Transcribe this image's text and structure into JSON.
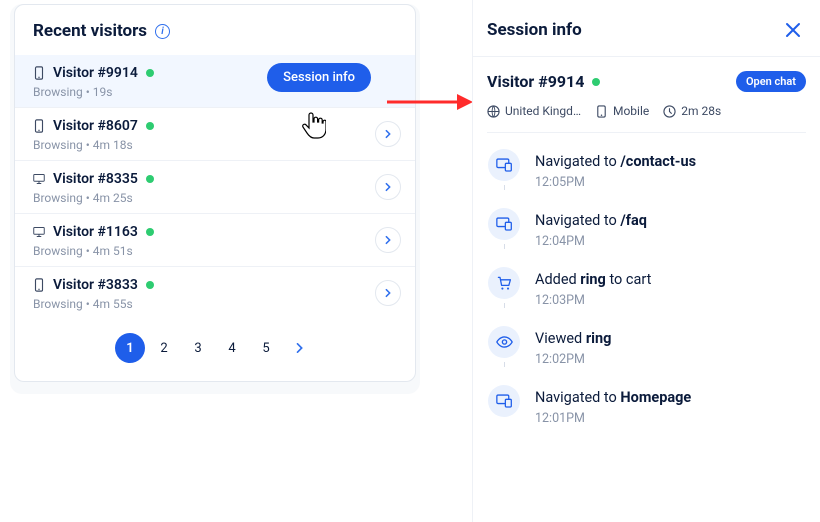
{
  "left": {
    "title": "Recent visitors",
    "visitors": [
      {
        "id": "Visitor #9914",
        "device": "mobile",
        "status": "Browsing",
        "duration": "19s",
        "highlighted": true,
        "pill": "Session info"
      },
      {
        "id": "Visitor #8607",
        "device": "mobile",
        "status": "Browsing",
        "duration": "4m 18s"
      },
      {
        "id": "Visitor #8335",
        "device": "desktop",
        "status": "Browsing",
        "duration": "4m 25s"
      },
      {
        "id": "Visitor #1163",
        "device": "desktop",
        "status": "Browsing",
        "duration": "4m 51s"
      },
      {
        "id": "Visitor #3833",
        "device": "mobile",
        "status": "Browsing",
        "duration": "4m 55s"
      }
    ],
    "pages": [
      "1",
      "2",
      "3",
      "4",
      "5"
    ],
    "active_page": "1"
  },
  "right": {
    "header": "Session info",
    "visitor": "Visitor #9914",
    "open_chat": "Open chat",
    "meta": {
      "country": "United Kingd…",
      "device": "Mobile",
      "duration": "2m 28s"
    },
    "timeline": [
      {
        "icon": "nav",
        "prefix": "Navigated to ",
        "bold": "/contact-us",
        "suffix": "",
        "time": "12:05PM"
      },
      {
        "icon": "nav",
        "prefix": "Navigated to ",
        "bold": "/faq",
        "suffix": "",
        "time": "12:04PM"
      },
      {
        "icon": "cart",
        "prefix": "Added ",
        "bold": "ring",
        "suffix": " to cart",
        "time": "12:03PM"
      },
      {
        "icon": "eye",
        "prefix": "Viewed ",
        "bold": "ring",
        "suffix": "",
        "time": "12:02PM"
      },
      {
        "icon": "nav",
        "prefix": "Navigated to ",
        "bold": "Homepage",
        "suffix": "",
        "time": "12:01PM"
      }
    ]
  }
}
